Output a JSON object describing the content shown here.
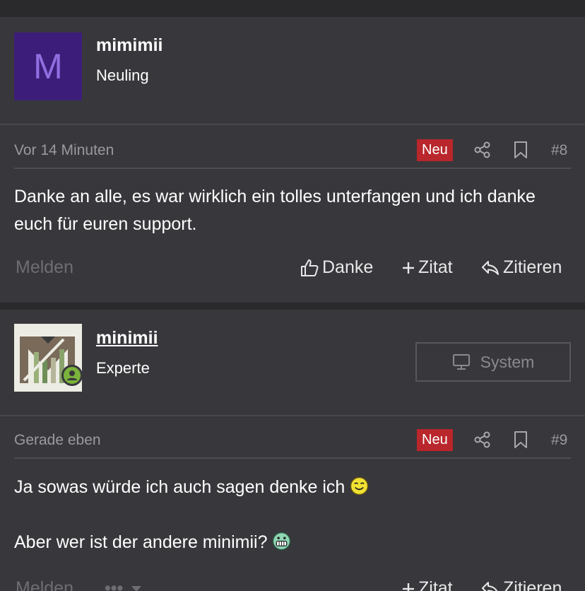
{
  "posts": [
    {
      "author": {
        "name": "mimimii",
        "rank": "Neuling",
        "avatar_letter": "M"
      },
      "meta": {
        "time": "Vor 14 Minuten",
        "badge": "Neu",
        "number": "#8"
      },
      "content": [
        "Danke an alle, es war wirklich ein tolles unterfangen und ich danke euch für euren support."
      ],
      "footer": {
        "report": "Melden",
        "thanks": "Danke",
        "multiquote": "Zitat",
        "reply": "Zitieren"
      }
    },
    {
      "author": {
        "name": "minimii",
        "rank": "Experte",
        "button": "System"
      },
      "meta": {
        "time": "Gerade eben",
        "badge": "Neu",
        "number": "#9"
      },
      "content": [
        "Ja sowas würde ich auch sagen denke ich",
        "Aber wer ist der andere minimii?"
      ],
      "footer": {
        "report": "Melden",
        "more": "•••",
        "multiquote": "Zitat",
        "reply": "Zitieren"
      }
    }
  ],
  "icons": {
    "share": "share-icon",
    "bookmark": "bookmark-icon",
    "thumbs": "thumbs-up-icon",
    "plus": "plus-icon",
    "reply": "reply-icon",
    "monitor": "monitor-icon",
    "online": "online-user-icon",
    "smile": "wink-smiley-icon",
    "grin": "grin-smiley-icon",
    "chevron": "chevron-down-icon"
  },
  "colors": {
    "badge": "#b9262b",
    "online": "#7bb33a",
    "avatar_bg": "#3d1d7a"
  }
}
